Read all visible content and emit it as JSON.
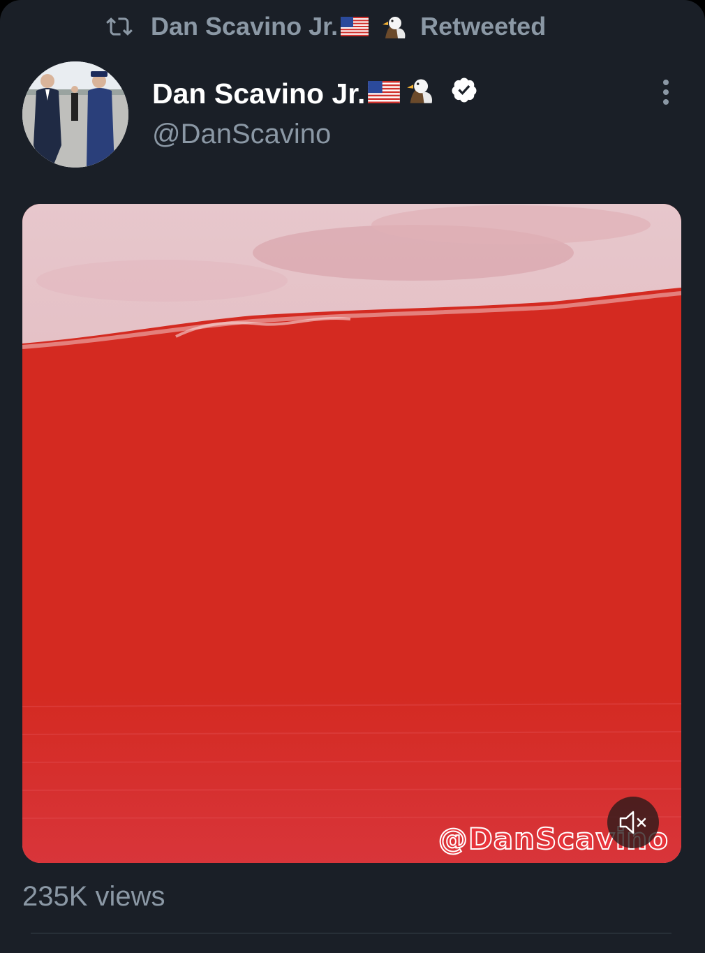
{
  "retweet_bar": {
    "retweeter_name": "Dan Scavino Jr.",
    "action_text": "Retweeted"
  },
  "author": {
    "display_name": "Dan Scavino Jr.",
    "handle": "@DanScavino",
    "verified": true
  },
  "media": {
    "watermark": "@DanScavino",
    "muted": true
  },
  "stats": {
    "views_text": "235K views"
  },
  "colors": {
    "background": "#1a1f27",
    "secondary_text": "#8b98a5",
    "primary_text": "#ffffff",
    "media_red": "#d52a22"
  }
}
